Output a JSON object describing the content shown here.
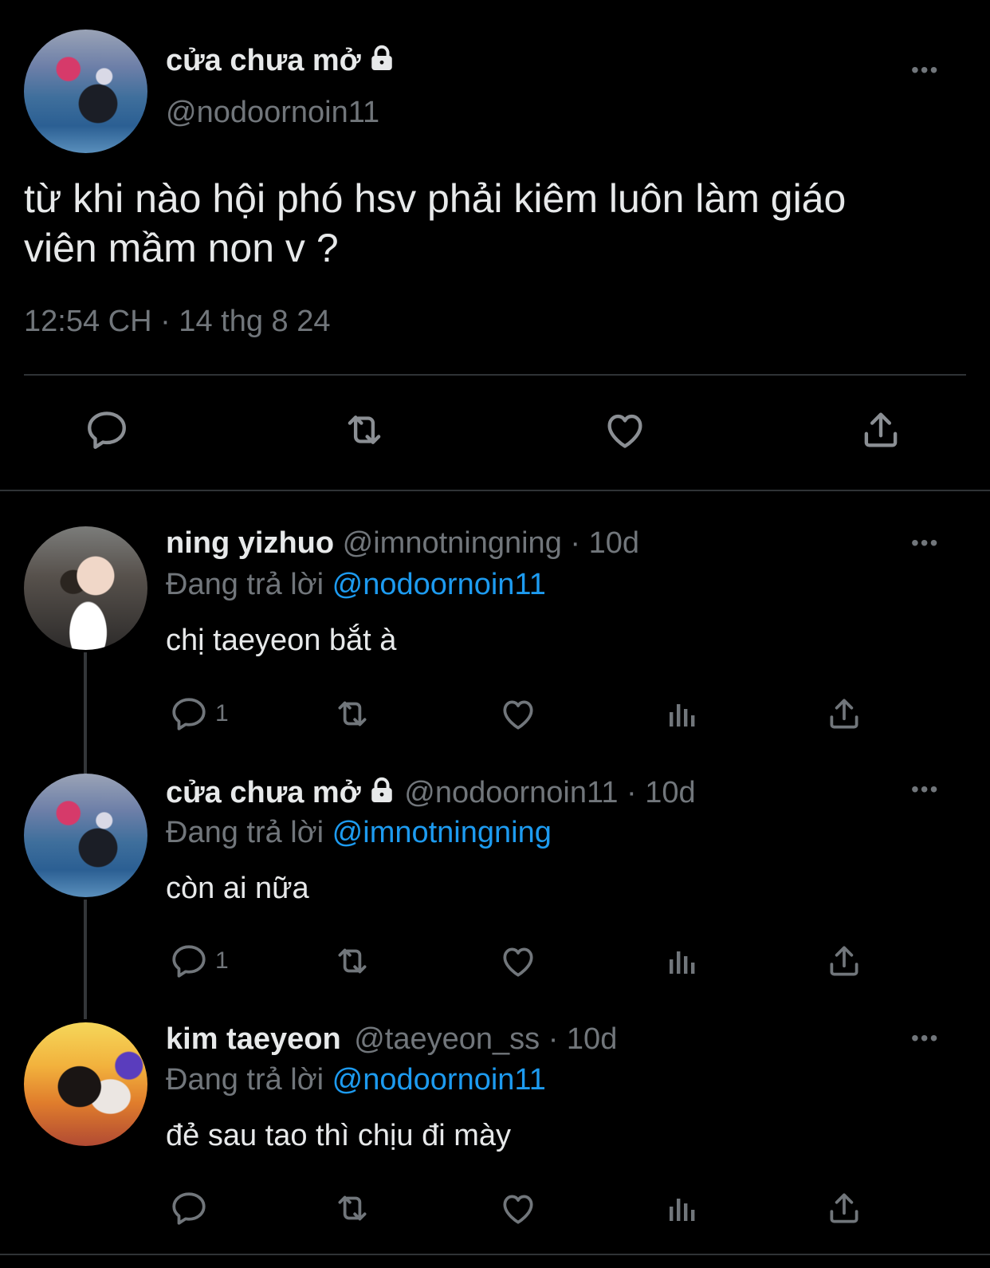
{
  "main_tweet": {
    "display_name": "cửa chưa mở",
    "handle": "@nodoornoin11",
    "text_line1": "từ khi nào hội phó hsv phải kiêm luôn làm giáo",
    "text_line2": "viên mầm non v ?",
    "timestamp": "12:54 CH · 14 thg 8 24"
  },
  "replies": [
    {
      "display_name": "ning yizhuo",
      "handle_time": "@imnotningning · 10d",
      "replying_prefix": "Đang trả lời",
      "replying_to": "@nodoornoin11",
      "text": "chị taeyeon bắt à",
      "reply_count": "1"
    },
    {
      "display_name": "cửa chưa mở",
      "handle_time": "@nodoornoin11 · 10d",
      "replying_prefix": "Đang trả lời",
      "replying_to": "@imnotningning",
      "text": "còn ai nữa",
      "reply_count": "1"
    },
    {
      "display_name": "kim taeyeon",
      "handle_time": "@taeyeon_ss · 10d",
      "replying_prefix": "Đang trả lời",
      "replying_to": "@nodoornoin11",
      "text": "đẻ sau tao thì chịu đi mày",
      "reply_count": ""
    }
  ],
  "more_label": "•••",
  "colors": {
    "background": "#000000",
    "link": "#1d9bf0",
    "muted": "#71767b"
  },
  "icons": [
    "lock-icon",
    "reply-icon",
    "retweet-icon",
    "like-icon",
    "views-icon",
    "share-icon",
    "more-icon"
  ]
}
